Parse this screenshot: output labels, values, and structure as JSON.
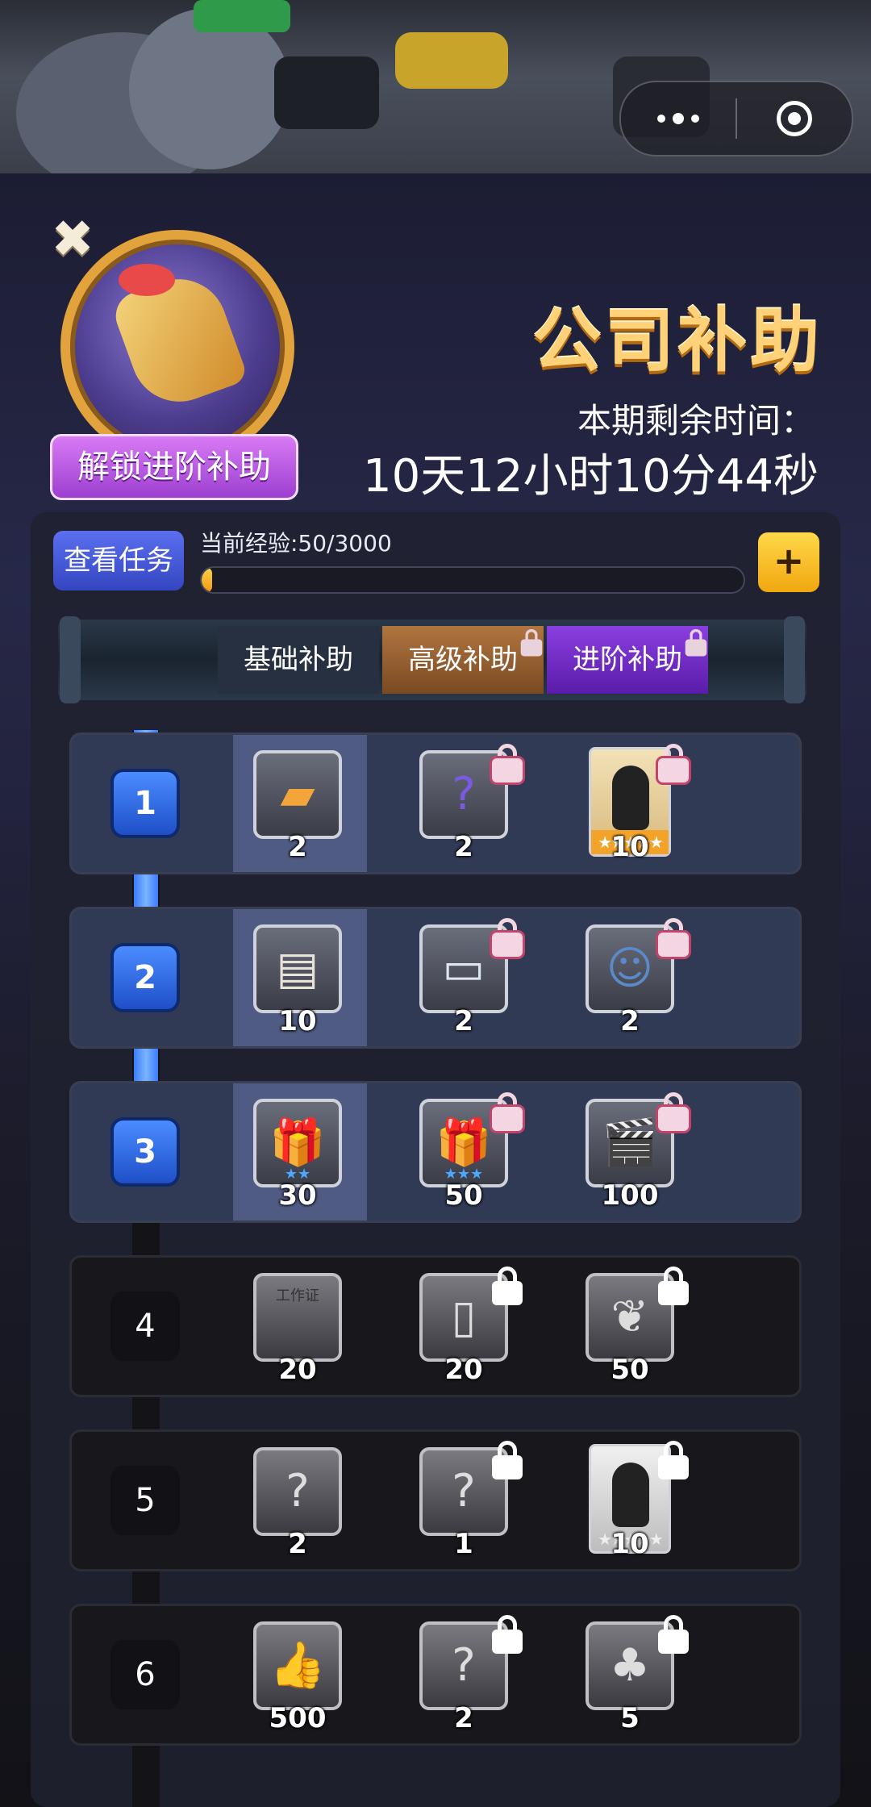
{
  "topbar": {
    "more_icon": "more-dots-icon",
    "close_icon": "target-icon"
  },
  "header": {
    "close_icon": "close-icon",
    "unlock_button": "解锁进阶补助",
    "title": "公司补助",
    "remaining_label": "本期剩余时间：",
    "remaining_value": "10天12小时10分44秒"
  },
  "progress": {
    "task_button": "查看任务",
    "exp_label": "当前经验:50/3000",
    "exp_current": 50,
    "exp_max": 3000,
    "plus_label": "+"
  },
  "tabs": [
    {
      "label": "基础补助",
      "locked": false
    },
    {
      "label": "高级补助",
      "locked": true
    },
    {
      "label": "进阶补助",
      "locked": true
    }
  ],
  "levels": [
    {
      "level": "1",
      "active": true,
      "rewards": [
        {
          "qty": "2",
          "icon": "orange-ticket-icon",
          "locked": false
        },
        {
          "qty": "2",
          "icon": "purple-mystery-card-icon",
          "locked": true
        },
        {
          "qty": "10",
          "icon": "character-portrait-icon",
          "locked": true,
          "stars": "★★★★★"
        }
      ]
    },
    {
      "level": "2",
      "active": true,
      "rewards": [
        {
          "qty": "10",
          "icon": "newspaper-icon",
          "locked": false
        },
        {
          "qty": "2",
          "icon": "id-card-icon",
          "locked": true
        },
        {
          "qty": "2",
          "icon": "group-card-icon",
          "locked": true
        }
      ]
    },
    {
      "level": "3",
      "active": true,
      "rewards": [
        {
          "qty": "30",
          "icon": "gift-box-icon",
          "locked": false,
          "stars": "★★"
        },
        {
          "qty": "50",
          "icon": "gift-box-icon",
          "locked": true,
          "stars": "★★★"
        },
        {
          "qty": "100",
          "icon": "clapperboard-icon",
          "locked": true
        }
      ]
    },
    {
      "level": "4",
      "active": false,
      "rewards": [
        {
          "qty": "20",
          "icon": "work-permit-icon",
          "locked": false,
          "text": "工作证"
        },
        {
          "qty": "20",
          "icon": "poster-icon",
          "locked": true
        },
        {
          "qty": "50",
          "icon": "book-icon",
          "locked": true
        }
      ]
    },
    {
      "level": "5",
      "active": false,
      "rewards": [
        {
          "qty": "2",
          "icon": "mystery-card-icon",
          "locked": false
        },
        {
          "qty": "1",
          "icon": "mystery-card-icon",
          "locked": true
        },
        {
          "qty": "10",
          "icon": "character-portrait-icon",
          "locked": true,
          "stars": "★★★★★"
        }
      ]
    },
    {
      "level": "6",
      "active": false,
      "rewards": [
        {
          "qty": "500",
          "icon": "thumbs-up-icon",
          "locked": false
        },
        {
          "qty": "2",
          "icon": "mystery-card-icon",
          "locked": true
        },
        {
          "qty": "5",
          "icon": "clover-card-icon",
          "locked": true
        }
      ]
    }
  ]
}
